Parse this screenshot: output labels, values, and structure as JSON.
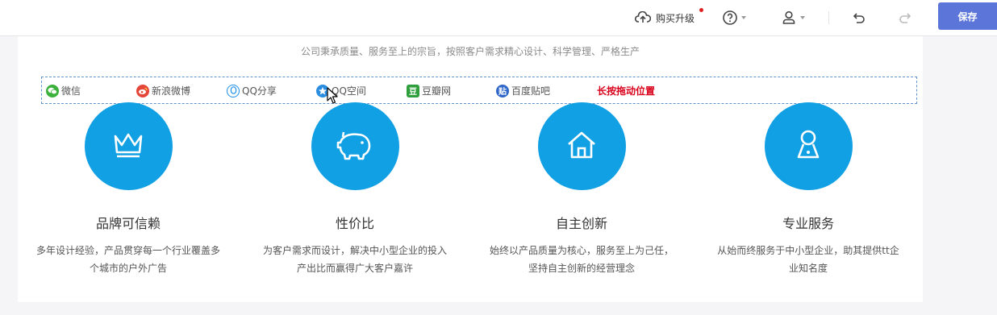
{
  "toolbar": {
    "upgrade_label": "购买升级",
    "save_label": "保存"
  },
  "section": {
    "slogan": "公司秉承质量、服务至上的宗旨，按照客户需求精心设计、科学管理、严格生产"
  },
  "share": {
    "items": [
      {
        "label": "微信",
        "icon": "wechat-icon",
        "color": "#3bb13b"
      },
      {
        "label": "新浪微博",
        "icon": "weibo-icon",
        "color": "#e6453a"
      },
      {
        "label": "QQ分享",
        "icon": "qq-icon",
        "color": "#1e8ee9"
      },
      {
        "label": "QQ空间",
        "icon": "qzone-icon",
        "color": "#2b8de0"
      },
      {
        "label": "豆瓣网",
        "icon": "douban-icon",
        "color": "#2e9f3a"
      },
      {
        "label": "百度贴吧",
        "icon": "tieba-icon",
        "color": "#2e67c9"
      }
    ],
    "drag_hint": "长按拖动位置"
  },
  "features": [
    {
      "icon": "crown-icon",
      "title": "品牌可信赖",
      "desc": "多年设计经验，产品贯穿每一个行业覆盖多个城市的户外广告"
    },
    {
      "icon": "piggy-bank-icon",
      "title": "性价比",
      "desc": "为客户需求而设计，解决中小型企业的投入产出比而赢得广大客户嘉许"
    },
    {
      "icon": "home-icon",
      "title": "自主创新",
      "desc": "始终以产品质量为核心，服务至上为己任，坚持自主创新的经营理念"
    },
    {
      "icon": "user-icon",
      "title": "专业服务",
      "desc": "从始而终服务于中小型企业，助其提供tt企业知名度"
    }
  ],
  "colors": {
    "accent": "#12a0e4",
    "primary_button": "#5b75d8",
    "hint_red": "#d9001b"
  }
}
